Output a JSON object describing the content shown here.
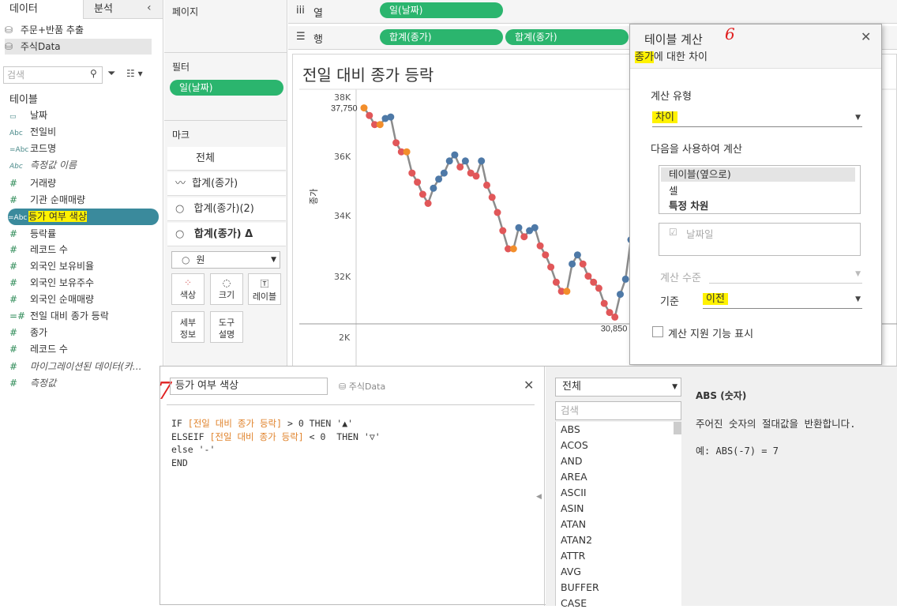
{
  "datapane": {
    "tab_data": "데이터",
    "tab_analysis": "분석",
    "collapse_icon": "chevron-left",
    "sources": [
      "주문+반품 추출",
      "주식Data"
    ],
    "search_placeholder": "검색",
    "tables_header": "테이블",
    "fields": [
      {
        "type": "date",
        "icon": "calendar",
        "label": "날짜"
      },
      {
        "type": "abc",
        "icon": "Abc",
        "label": "전일비"
      },
      {
        "type": "abc",
        "icon": "=Abc",
        "label": "코드명"
      },
      {
        "type": "abc",
        "icon": "Abc",
        "label": "측정값 이름"
      },
      {
        "type": "num",
        "icon": "#",
        "label": "거래량"
      },
      {
        "type": "num",
        "icon": "#",
        "label": "기관 순매매량"
      },
      {
        "type": "abc",
        "icon": "=Abc",
        "label": "등가 여부 색상"
      },
      {
        "type": "num",
        "icon": "#",
        "label": "등락률"
      },
      {
        "type": "num",
        "icon": "#",
        "label": "레코드 수"
      },
      {
        "type": "num",
        "icon": "#",
        "label": "외국인 보유비율"
      },
      {
        "type": "num",
        "icon": "#",
        "label": "외국인 보유주수"
      },
      {
        "type": "num",
        "icon": "#",
        "label": "외국인 순매매량"
      },
      {
        "type": "num",
        "icon": "=#",
        "label": "전일 대비 종가 등락"
      },
      {
        "type": "num",
        "icon": "#",
        "label": "종가"
      },
      {
        "type": "num",
        "icon": "#",
        "label": "레코드 수"
      },
      {
        "type": "num",
        "icon": "#",
        "label": "마이그레이션된 데이터(카..."
      },
      {
        "type": "num",
        "icon": "#",
        "label": "측정값"
      }
    ]
  },
  "shelves": {
    "pages_title": "페이지",
    "filters_title": "필터",
    "filter_pill": "일(날짜)",
    "marks_title": "마크",
    "marks_rows": [
      "전체",
      "합계(종가)",
      "합계(종가)(2)",
      "합계(종가) Δ"
    ],
    "mark_type": "원",
    "mark_buttons": [
      "색상",
      "크기",
      "레이블",
      "세부\n정보",
      "도구\n설명"
    ],
    "columns_label": "열",
    "columns_pill": "일(날짜)",
    "rows_label": "행",
    "rows_pills": [
      "합계(종가)",
      "합계(종가)"
    ]
  },
  "chart": {
    "title": "전일 대비 종가 등락",
    "ylabel": "종가",
    "yticks": [
      "38K",
      "36K",
      "34K",
      "32K",
      "2K"
    ],
    "labels": {
      "max": "37,750",
      "min": "30,850"
    }
  },
  "chart_data": {
    "type": "line",
    "title": "전일 대비 종가 등락",
    "ylabel": "종가",
    "ylim": [
      30000,
      38000
    ],
    "yticks": [
      32000,
      34000,
      36000,
      38000
    ],
    "series": [
      {
        "values": [
          37750,
          37500,
          37200,
          37200,
          37400,
          37450,
          36600,
          36300,
          36300,
          35600,
          35300,
          34900,
          34600,
          35100,
          35400,
          35600,
          36000,
          36200,
          35800,
          36000,
          35600,
          35500,
          36000,
          35200,
          34800,
          34300,
          33700,
          33100,
          33100,
          33800,
          33500,
          33700,
          33800,
          33200,
          32900,
          32500,
          32000,
          31700,
          31700,
          32600,
          32900,
          32600,
          32200,
          32000,
          31800,
          31300,
          31000,
          30850,
          31600,
          32100,
          33400
        ]
      }
    ],
    "point_colors": {
      "up": "#4e79a7",
      "down": "#e15759",
      "same": "#f28e2b"
    },
    "annotations": [
      "37,750",
      "30,850"
    ]
  },
  "calc_dialog": {
    "title": "테이블 계산",
    "annotation_number": "6",
    "subtitle_field": "종가",
    "subtitle_rest": "에 대한 차이",
    "calc_type_label": "계산 유형",
    "calc_type_value": "차이",
    "compute_using_label": "다음을 사용하여 계산",
    "compute_using_options": [
      "테이블(옆으로)",
      "셀",
      "특정 차원"
    ],
    "dimension_checkbox": "날짜일",
    "level_label": "계산 수준",
    "relative_label": "기준",
    "relative_value": "이전",
    "show_helper": "계산 지원 기능 표시"
  },
  "calc_editor": {
    "annotation_number": "7",
    "name": "등가 여부 색상",
    "datasource": "주식Data",
    "code_lines": [
      {
        "parts": [
          {
            "t": "IF ",
            "f": false
          },
          {
            "t": "[전일 대비 종가 등락]",
            "f": true
          },
          {
            "t": " > 0 THEN '▲'",
            "f": false
          }
        ]
      },
      {
        "parts": [
          {
            "t": "ELSEIF ",
            "f": false
          },
          {
            "t": "[전일 대비 종가 등락]",
            "f": true
          },
          {
            "t": " < 0  THEN '▽'",
            "f": false
          }
        ]
      },
      {
        "parts": [
          {
            "t": "else '-'",
            "f": false
          }
        ]
      },
      {
        "parts": [
          {
            "t": "END",
            "f": false
          }
        ]
      }
    ],
    "function_filter": "전체",
    "function_search": "검색",
    "functions": [
      "ABS",
      "ACOS",
      "AND",
      "AREA",
      "ASCII",
      "ASIN",
      "ATAN",
      "ATAN2",
      "ATTR",
      "AVG",
      "BUFFER",
      "CASE"
    ],
    "help_title": "ABS (숫자)",
    "help_desc": "주어진 숫자의 절대값을 반환합니다.",
    "help_example": "예: ABS(-7) = 7"
  }
}
